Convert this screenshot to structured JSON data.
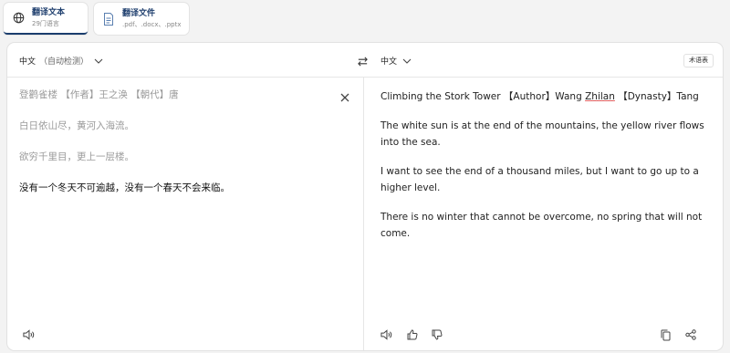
{
  "modes": {
    "text": {
      "title": "翻译文本",
      "sub": "29门语言",
      "icon": "globe-icon"
    },
    "file": {
      "title": "翻译文件",
      "sub": ".pdf、.docx、.pptx",
      "icon": "document-icon"
    }
  },
  "source": {
    "lang": "中文",
    "detect_hint": "（自动检测）",
    "lines": [
      {
        "a": "登鹳雀楼",
        "b": "【作者】王之涣",
        "c": "【朝代】唐"
      },
      "白日依山尽，黄河入海流。",
      "欲穷千里目，更上一层楼。",
      "没有一个冬天不可逾越，没有一个春天不会来临。"
    ]
  },
  "target": {
    "lang": "中文",
    "glossary_label": "术语表",
    "title_line": {
      "a": "Climbing the Stork Tower",
      "b": "【Author】Wang",
      "name": "Zhilan",
      "c": "【Dynasty】Tang"
    },
    "lines": [
      "The white sun is at the end of the mountains, the yellow river flows into the sea.",
      "I want to see the end of a thousand miles, but I want to go up to a higher level.",
      "There is no winter that cannot be overcome, no spring that will not come."
    ]
  },
  "colors": {
    "accent": "#1a3d6d",
    "muted_text": "#9a9a9a",
    "border": "#e2e2e2"
  }
}
